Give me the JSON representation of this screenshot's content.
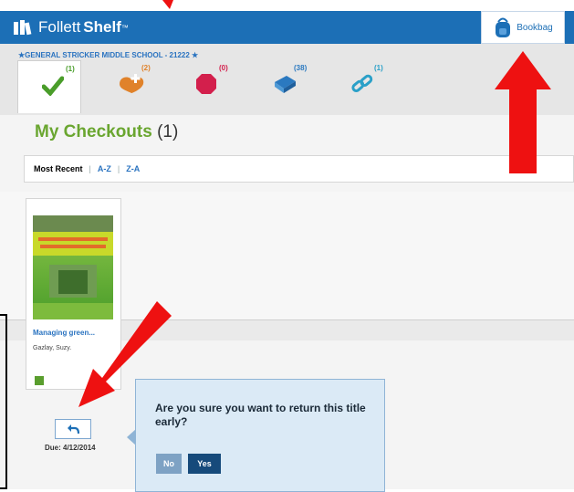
{
  "app": {
    "name_part1": "Follett",
    "name_part2": "Shelf",
    "tm": "™",
    "bookbag_label": "Bookbag"
  },
  "school": {
    "name": "★GENERAL STRICKER MIDDLE SCHOOL - 21222 ★"
  },
  "tabs": [
    {
      "icon": "checkmark-icon",
      "count": "(1)",
      "color": "#4a9d2a"
    },
    {
      "icon": "hold-icon",
      "count": "(2)",
      "color": "#e0822a"
    },
    {
      "icon": "stop-icon",
      "count": "(0)",
      "color": "#d31f4c"
    },
    {
      "icon": "book-icon",
      "count": "(38)",
      "color": "#2b79c0"
    },
    {
      "icon": "link-icon",
      "count": "(1)",
      "color": "#2aa0c8"
    }
  ],
  "page": {
    "title": "My Checkouts",
    "title_count": "(1)"
  },
  "sort": {
    "most_recent": "Most Recent",
    "sep": "|",
    "az": "A-Z",
    "za": "Z-A"
  },
  "book": {
    "title": "Managing green...",
    "author": "Gazlay, Suzy.",
    "due": "Due: 4/12/2014"
  },
  "dialog": {
    "question": "Are you sure you want to return this title early?",
    "no": "No",
    "yes": "Yes"
  },
  "colors": {
    "header": "#1c6fb6",
    "title_green": "#6aa630",
    "annotation_red": "#ee1111"
  }
}
